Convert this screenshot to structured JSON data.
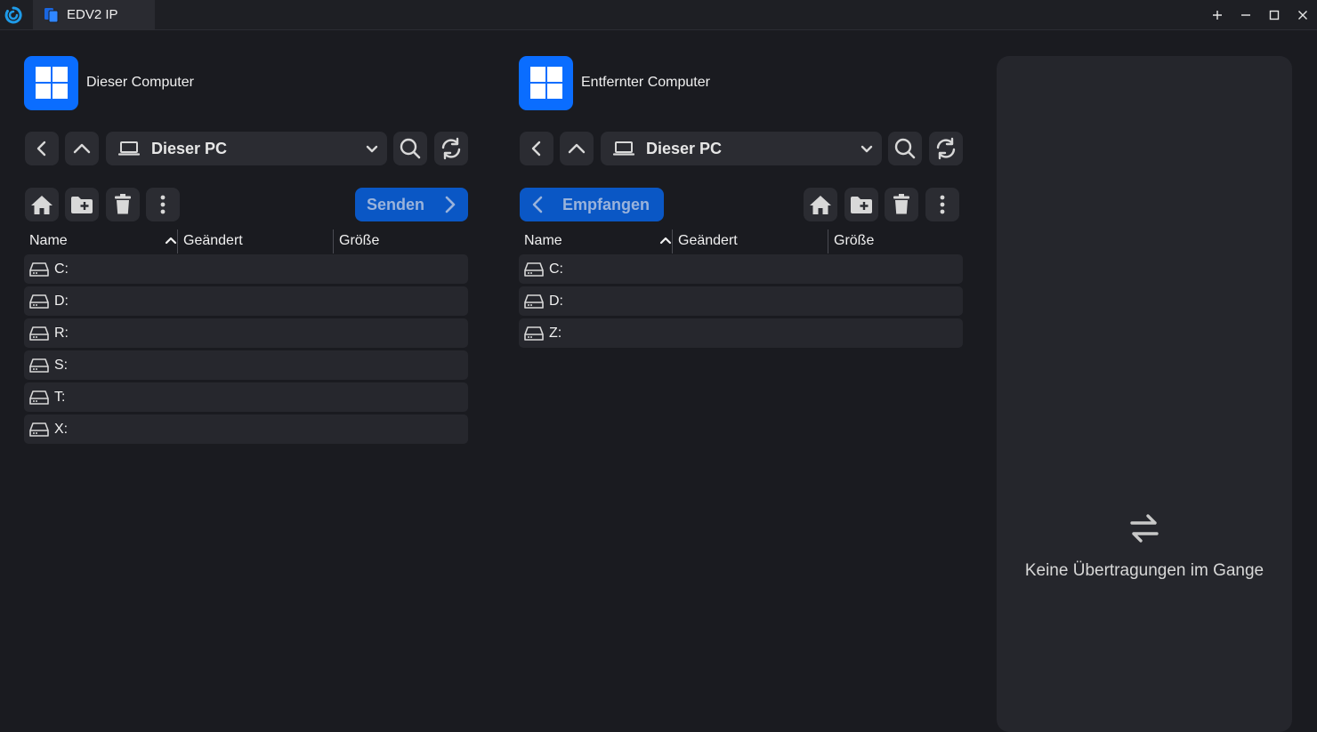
{
  "titlebar": {
    "tab_title": "EDV2 IP",
    "controls": [
      "add-tab",
      "minimize",
      "maximize",
      "close"
    ],
    "accent": "#0a6dff"
  },
  "local": {
    "title": "Dieser Computer",
    "path": "Dieser PC",
    "action_label": "Senden",
    "columns": {
      "name": "Name",
      "modified": "Geändert",
      "size": "Größe"
    },
    "drives": [
      {
        "name": "C:"
      },
      {
        "name": "D:"
      },
      {
        "name": "R:"
      },
      {
        "name": "S:"
      },
      {
        "name": "T:"
      },
      {
        "name": "X:"
      }
    ]
  },
  "remote": {
    "title": "Entfernter Computer",
    "path": "Dieser PC",
    "action_label": "Empfangen",
    "columns": {
      "name": "Name",
      "modified": "Geändert",
      "size": "Größe"
    },
    "drives": [
      {
        "name": "C:"
      },
      {
        "name": "D:"
      },
      {
        "name": "Z:"
      }
    ]
  },
  "transfers": {
    "empty_text": "Keine Übertragungen im Gange"
  },
  "colors": {
    "background": "#1a1b20",
    "panel": "#25262c",
    "button": "#2b2c32",
    "primary": "#0a57c5",
    "windows_blue": "#0a6dff"
  }
}
